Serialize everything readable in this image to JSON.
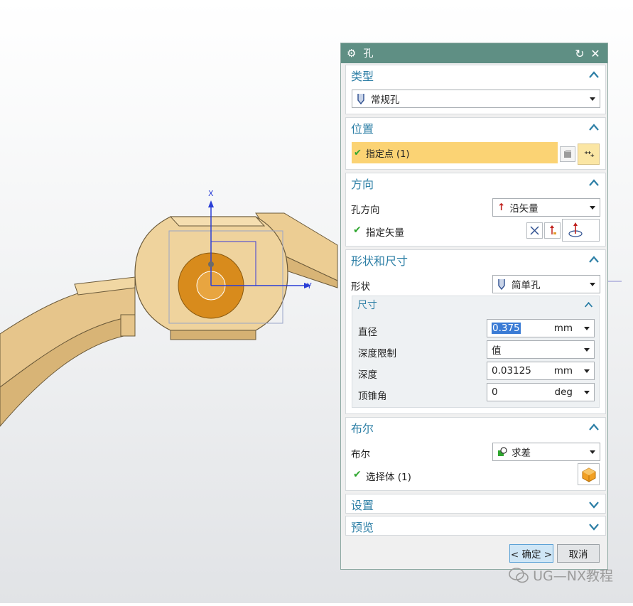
{
  "viewport": {
    "axis_x": "X",
    "axis_y": "Y",
    "model_color": "#eccd93",
    "hole_color": "#d88b1c"
  },
  "dialog": {
    "title": "孔",
    "title_icon": "gear-icon",
    "reset_icon": "reset-icon",
    "close_icon": "close-icon"
  },
  "type_group": {
    "header": "类型",
    "selected": "常规孔"
  },
  "position_group": {
    "header": "位置",
    "specify_point": "指定点 (1)"
  },
  "direction_group": {
    "header": "方向",
    "hole_direction_label": "孔方向",
    "hole_direction_value": "沿矢量",
    "specify_vector": "指定矢量"
  },
  "shape_group": {
    "header": "形状和尺寸",
    "shape_label": "形状",
    "shape_value": "简单孔",
    "dimensions": {
      "header": "尺寸",
      "diameter_label": "直径",
      "diameter_value": "0.375",
      "diameter_unit": "mm",
      "depth_limit_label": "深度限制",
      "depth_limit_value": "值",
      "depth_label": "深度",
      "depth_value": "0.03125",
      "depth_unit": "mm",
      "tip_angle_label": "顶锥角",
      "tip_angle_value": "0",
      "tip_angle_unit": "deg"
    }
  },
  "boolean_group": {
    "header": "布尔",
    "boolean_label": "布尔",
    "boolean_value": "求差",
    "select_body": "选择体 (1)"
  },
  "settings_group": {
    "header": "设置"
  },
  "preview_group": {
    "header": "预览"
  },
  "footer": {
    "ok_label": "< 确定 >",
    "cancel_label": "取消"
  },
  "watermark": "UG—NX教程",
  "colors": {
    "header_text": "#2d7fa6",
    "title_bar": "#5f8f84",
    "highlight_row": "#fbd374",
    "selection": "#3a7bd5",
    "check": "#2fa62f"
  }
}
